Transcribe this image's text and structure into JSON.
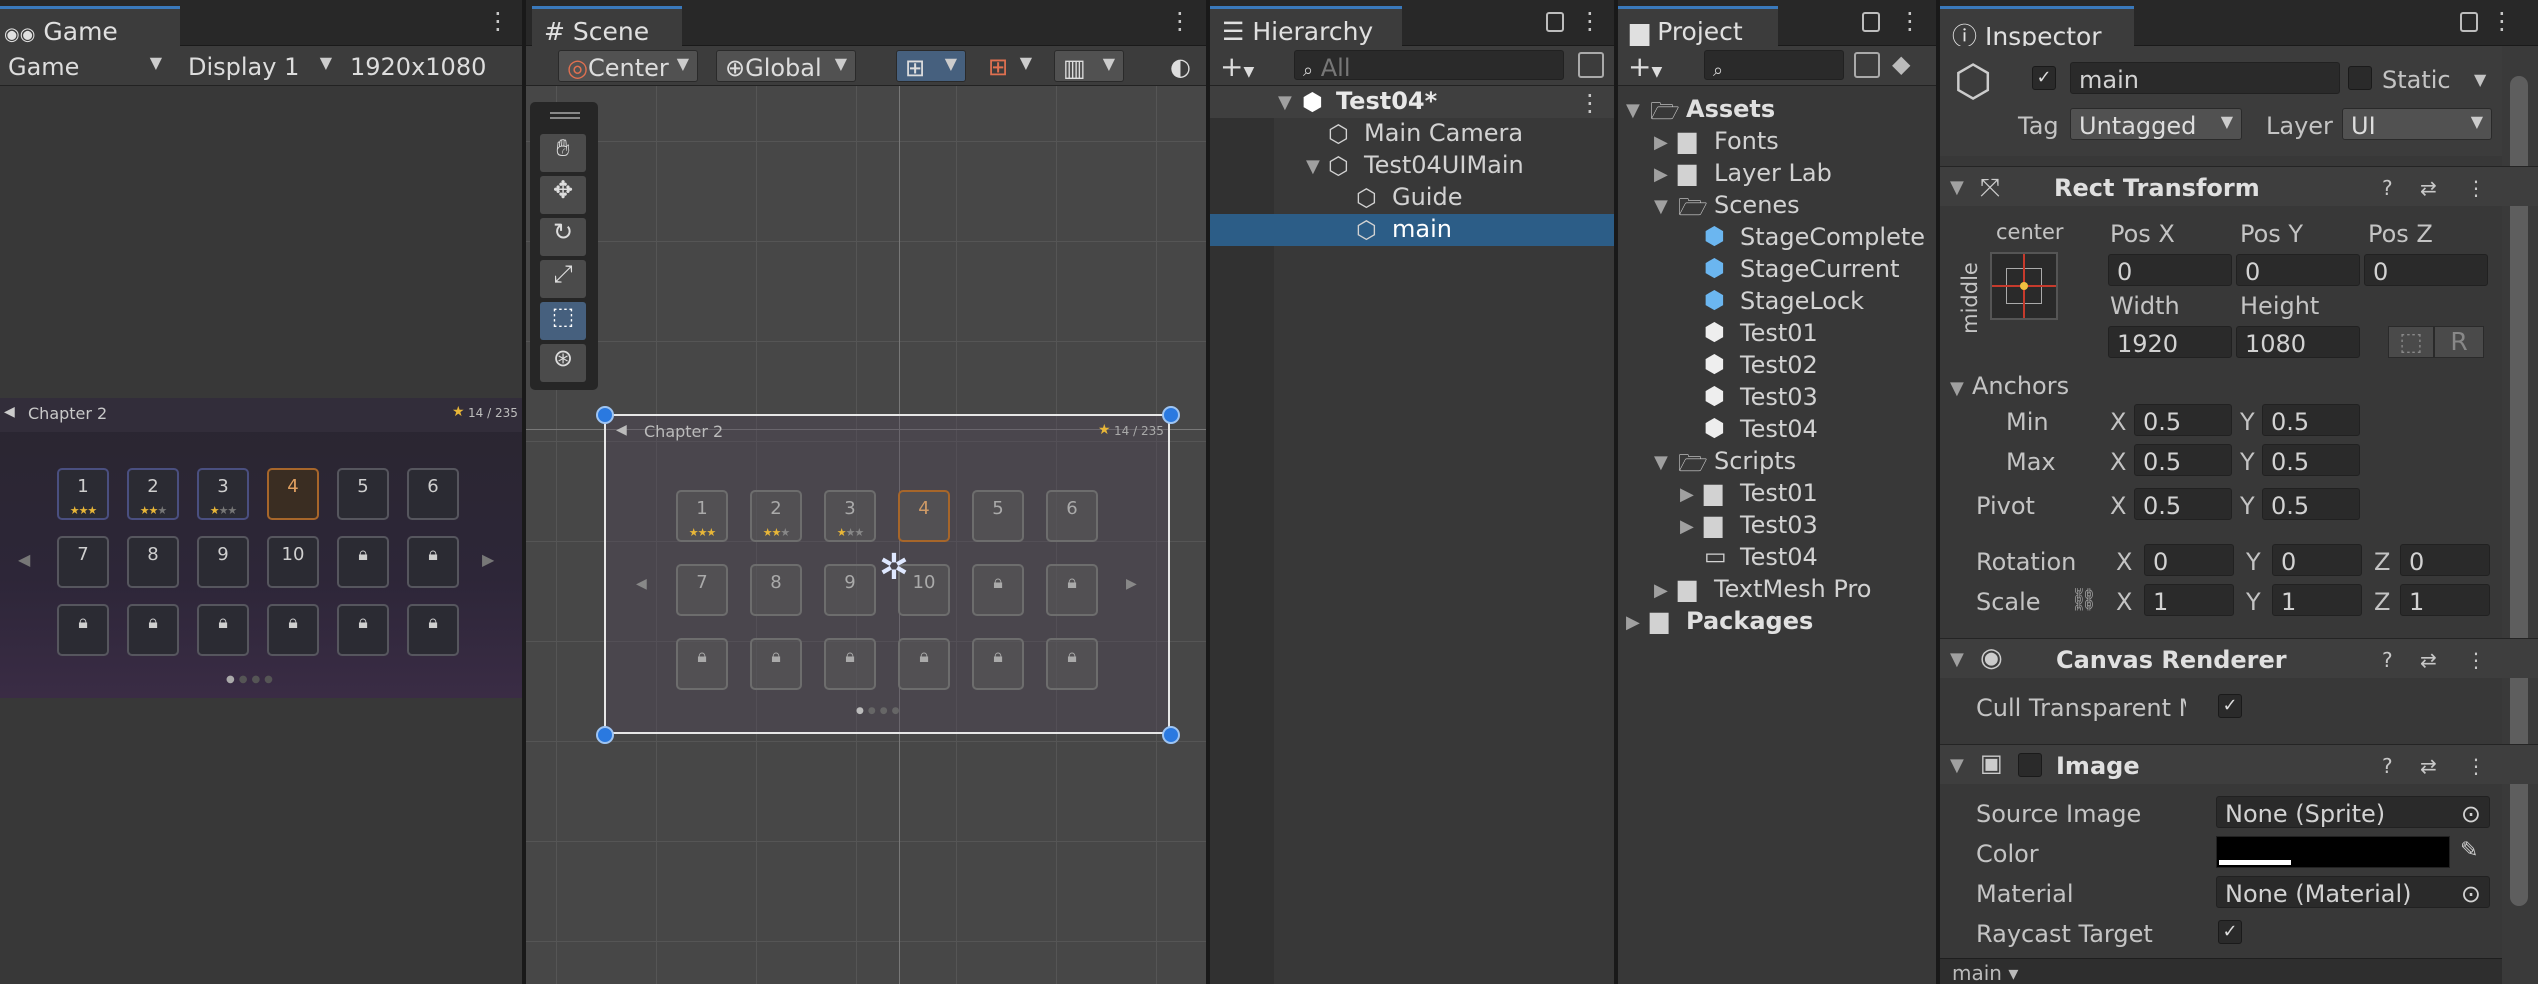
{
  "game": {
    "tab": "Game",
    "mode": "Game",
    "display": "Display 1",
    "resolution": "1920x1080",
    "chapter": "Chapter 2",
    "star_count": "14 / 235",
    "levels_row1": [
      "1",
      "2",
      "3",
      "4",
      "5",
      "6"
    ],
    "levels_row2": [
      "7",
      "8",
      "9",
      "10"
    ]
  },
  "scene": {
    "tab": "Scene",
    "pivot": "Center",
    "space": "Global",
    "chapter": "Chapter 2",
    "star_count": "14 / 235",
    "levels_row1": [
      "1",
      "2",
      "3",
      "4",
      "5",
      "6"
    ],
    "levels_row2": [
      "7",
      "8",
      "9",
      "10"
    ]
  },
  "hierarchy": {
    "tab": "Hierarchy",
    "search_placeholder": "All",
    "items": [
      "Test04*",
      "Main Camera",
      "Test04UIMain",
      "Guide",
      "main"
    ]
  },
  "project": {
    "tab": "Project",
    "items": [
      "Assets",
      "Fonts",
      "Layer Lab",
      "Scenes",
      "StageComplete",
      "StageCurrent",
      "StageLock",
      "Test01",
      "Test02",
      "Test03",
      "Test04",
      "Scripts",
      "Test01",
      "Test03",
      "Test04",
      "TextMesh Pro",
      "Packages"
    ]
  },
  "inspector": {
    "tab": "Inspector",
    "object_name": "main",
    "static_label": "Static",
    "tag_label": "Tag",
    "tag_value": "Untagged",
    "layer_label": "Layer",
    "layer_value": "UI",
    "rect_transform": {
      "title": "Rect Transform",
      "anchor_h": "center",
      "anchor_v": "middle",
      "pos_x_label": "Pos X",
      "pos_y_label": "Pos Y",
      "pos_z_label": "Pos Z",
      "pos_x": "0",
      "pos_y": "0",
      "pos_z": "0",
      "width_label": "Width",
      "height_label": "Height",
      "width": "1920",
      "height": "1080",
      "r_label": "R",
      "anchors_label": "Anchors",
      "min_label": "Min",
      "max_label": "Max",
      "pivot_label": "Pivot",
      "x": "X",
      "y": "Y",
      "z": "Z",
      "min_x": "0.5",
      "min_y": "0.5",
      "max_x": "0.5",
      "max_y": "0.5",
      "pivot_x": "0.5",
      "pivot_y": "0.5",
      "rotation_label": "Rotation",
      "scale_label": "Scale",
      "rot_x": "0",
      "rot_y": "0",
      "rot_z": "0",
      "scale_x": "1",
      "scale_y": "1",
      "scale_z": "1"
    },
    "canvas_renderer": {
      "title": "Canvas Renderer",
      "cull_label": "Cull Transparent Mes"
    },
    "image": {
      "title": "Image",
      "source_label": "Source Image",
      "source_value": "None (Sprite)",
      "color_label": "Color",
      "material_label": "Material",
      "material_value": "None (Material)",
      "raycast_label": "Raycast Target"
    },
    "footer": "main ▾"
  },
  "colors": {
    "accent": "#3a79bb",
    "selection": "#2c5d87"
  }
}
